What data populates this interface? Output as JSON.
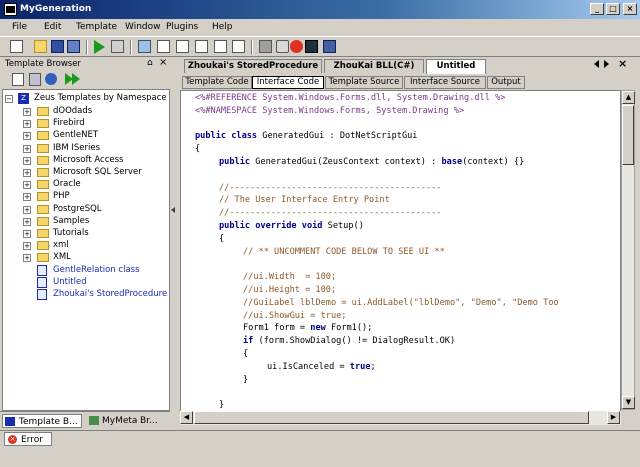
{
  "window": {
    "title": "MyGeneration"
  },
  "menu": [
    "File",
    "Edit",
    "Template",
    "Window",
    "Plugins",
    "Help"
  ],
  "left_panel": {
    "title": "Template Browser",
    "pin_glyph": "⌂",
    "close_glyph": "×",
    "tree_root": "Zeus Templates by Namespace",
    "folders": [
      "dOOdads",
      "Firebird",
      "GentleNET",
      "IBM ISeries",
      "Microsoft Access",
      "Microsoft SQL Server",
      "Oracle",
      "PHP",
      "PostgreSQL",
      "Samples",
      "Tutorials",
      "xml",
      "XML"
    ],
    "files": [
      "GentleRelation class",
      "Untitled",
      "Zhoukai's StoredProcedure"
    ],
    "bottom_tabs": [
      "Template B...",
      "MyMeta",
      "Br..."
    ]
  },
  "doc_tabs": [
    "Zhoukai's StoredProcedure",
    "ZhouKai BLL(C#)",
    "Untitled"
  ],
  "active_doc_tab": "Untitled",
  "sub_tabs": [
    "Template Code",
    "Interface Code",
    "Template Source",
    "Interface Source",
    "Output"
  ],
  "active_sub_tab": "Interface Code",
  "code_lines": [
    {
      "indent": 0,
      "parts": [
        [
          "gray",
          "<%#REFERENCE System.Windows.Forms.dll, System.Drawing.dll %>"
        ]
      ]
    },
    {
      "indent": 0,
      "parts": [
        [
          "gray",
          "<%#NAMESPACE System.Windows.Forms, System.Drawing %>"
        ]
      ]
    },
    {
      "indent": 0,
      "parts": []
    },
    {
      "indent": 0,
      "parts": [
        [
          "kw",
          "public class "
        ],
        [
          "pl",
          "GeneratedGui : DotNetScriptGui"
        ]
      ]
    },
    {
      "indent": 0,
      "parts": [
        [
          "pl",
          "{"
        ]
      ]
    },
    {
      "indent": 1,
      "parts": [
        [
          "kw",
          "public "
        ],
        [
          "pl",
          "GeneratedGui(ZeusContext context) : "
        ],
        [
          "kw",
          "base"
        ],
        [
          "pl",
          "(context) {}"
        ]
      ]
    },
    {
      "indent": 0,
      "parts": []
    },
    {
      "indent": 1,
      "parts": [
        [
          "cm",
          "//-----------------------------------------"
        ]
      ]
    },
    {
      "indent": 1,
      "parts": [
        [
          "cm",
          "// The User Interface Entry Point"
        ]
      ]
    },
    {
      "indent": 1,
      "parts": [
        [
          "cm",
          "//-----------------------------------------"
        ]
      ]
    },
    {
      "indent": 1,
      "parts": [
        [
          "kw",
          "public override void "
        ],
        [
          "pl",
          "Setup()"
        ]
      ]
    },
    {
      "indent": 1,
      "parts": [
        [
          "pl",
          "{"
        ]
      ]
    },
    {
      "indent": 2,
      "parts": [
        [
          "cm",
          "// ** UNCOMMENT CODE BELOW TO SEE UI **"
        ]
      ]
    },
    {
      "indent": 0,
      "parts": []
    },
    {
      "indent": 2,
      "parts": [
        [
          "cm",
          "//ui.Width  = 100;"
        ]
      ]
    },
    {
      "indent": 2,
      "parts": [
        [
          "cm",
          "//ui.Height = 100;"
        ]
      ]
    },
    {
      "indent": 2,
      "parts": [
        [
          "cm",
          "//GuiLabel lblDemo = ui.AddLabel(\"lblDemo\", \"Demo\", \"Demo Too"
        ]
      ]
    },
    {
      "indent": 2,
      "parts": [
        [
          "cm",
          "//ui.ShowGui = true;"
        ]
      ]
    },
    {
      "indent": 2,
      "parts": [
        [
          "pl",
          "Form1 form = "
        ],
        [
          "kw",
          "new "
        ],
        [
          "pl",
          "Form1();"
        ]
      ]
    },
    {
      "indent": 2,
      "parts": [
        [
          "kw",
          "if "
        ],
        [
          "pl",
          "(form.ShowDialog() != DialogResult.OK)"
        ]
      ]
    },
    {
      "indent": 2,
      "parts": [
        [
          "pl",
          "{"
        ]
      ]
    },
    {
      "indent": 3,
      "parts": [
        [
          "pl",
          "ui.IsCanceled = "
        ],
        [
          "kw",
          "true"
        ],
        [
          "pl",
          ";"
        ]
      ]
    },
    {
      "indent": 2,
      "parts": [
        [
          "pl",
          "}"
        ]
      ]
    },
    {
      "indent": 0,
      "parts": []
    },
    {
      "indent": 1,
      "parts": [
        [
          "pl",
          "}"
        ]
      ]
    }
  ],
  "status": {
    "error_tab": "Error"
  },
  "glyphs": {
    "minimize": "_",
    "maximize": "□",
    "close": "×",
    "up": "▲",
    "down": "▼",
    "left": "◀",
    "right": "▶",
    "expand": "+",
    "collapse": "−"
  },
  "colors": {
    "title_start": "#0a246a",
    "title_end": "#a6caf0",
    "keyword": "#00008b",
    "comment": "#8b5a2b",
    "directive": "#7a3a8a",
    "file_link": "#1a2cb0"
  }
}
